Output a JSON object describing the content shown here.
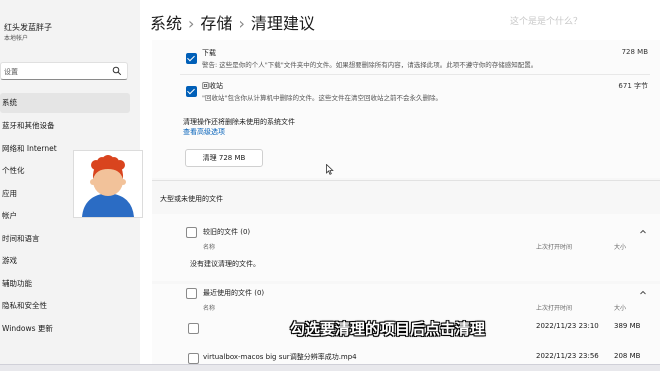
{
  "user": {
    "name": "红头发蓝胖子",
    "account": "本地帐户"
  },
  "search": {
    "placeholder": "设置"
  },
  "sidebar": {
    "items": [
      {
        "label": "系统",
        "active": true
      },
      {
        "label": "蓝牙和其他设备"
      },
      {
        "label": "网络和 Internet"
      },
      {
        "label": "个性化"
      },
      {
        "label": "应用"
      },
      {
        "label": "帐户"
      },
      {
        "label": "时间和语言"
      },
      {
        "label": "游戏"
      },
      {
        "label": "辅助功能"
      },
      {
        "label": "隐私和安全性"
      },
      {
        "label": "Windows 更新"
      }
    ]
  },
  "header": {
    "crumbs": [
      "系统",
      "存储",
      "清理建议"
    ],
    "separator": "›",
    "watermark": "这个是是个什么？"
  },
  "temp_files": {
    "items": [
      {
        "title": "下载",
        "size": "728 MB",
        "checked": true,
        "description": "警告: 这些是你的个人\"下载\"文件夹中的文件。如果想要删除所有内容，请选择此项。此项不遵守你的存储感知配置。"
      },
      {
        "title": "回收站",
        "size": "671 字节",
        "checked": true,
        "description": "\"回收站\"包含你从计算机中删除的文件。这些文件在清空回收站之前不会永久删除。"
      }
    ],
    "note": "清理操作还将删除未使用的系统文件",
    "advanced_link": "查看高级选项",
    "clean_button": "清理 728 MB"
  },
  "large_files": {
    "heading": "大型或未使用的文件",
    "groups": [
      {
        "title": "较旧的文件 (0)",
        "col_name": "名称",
        "col_date": "上次打开时间",
        "col_size": "大小",
        "empty_text": "没有建议清理的文件。"
      },
      {
        "title": "最近使用的文件 (0)",
        "col_name": "名称",
        "col_date": "上次打开时间",
        "col_size": "大小",
        "rows": [
          {
            "name": "",
            "date": "2022/11/23 23:10",
            "size": "389 MB"
          },
          {
            "name": "virtualbox-macos big sur调整分辨率成功.mp4",
            "date": "2022/11/23 23:56",
            "size": "208 MB"
          }
        ]
      }
    ]
  },
  "caption": "勾选要清理的项目后点击清理",
  "colors": {
    "accent": "#005fb8"
  }
}
